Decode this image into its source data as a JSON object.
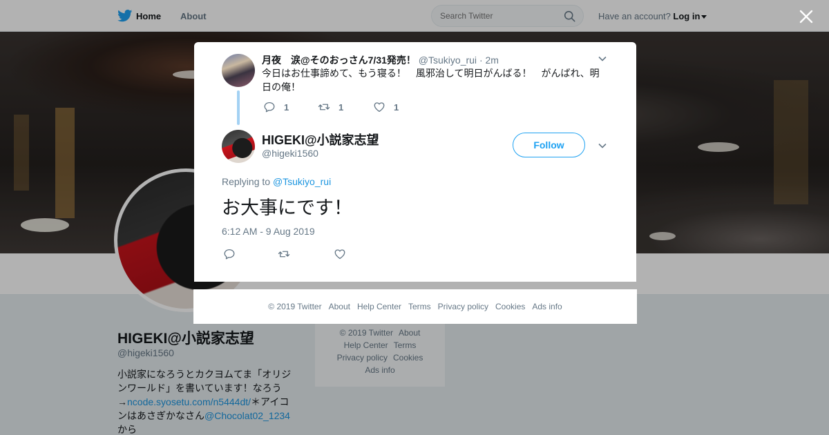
{
  "topbar": {
    "home_label": "Home",
    "about_label": "About",
    "search_placeholder": "Search Twitter",
    "account_prompt": "Have an account?",
    "login_label": "Log in"
  },
  "profile": {
    "name": "HIGEKI@小説家志望",
    "handle": "@higeki1560",
    "bio_part1": "小説家になろうとカクヨムてま「オリジンワールド」を書いています！なろう→",
    "bio_link1": "ncode.syosetu.com/n5444dt/",
    "bio_part2": "＊アイコンはあさぎかなさん",
    "bio_link2": "@Chocolat02_1234",
    "bio_part3": "から",
    "side_footer": {
      "copyright": "© 2019 Twitter",
      "about": "About",
      "help": "Help Center",
      "terms": "Terms",
      "privacy": "Privacy policy",
      "cookies": "Cookies",
      "ads": "Ads info"
    }
  },
  "modal": {
    "parent_tweet": {
      "name": "月夜　涙@そのおっさん7/31発売！",
      "handle": "@Tsukiyo_rui",
      "time": "· 2m",
      "text": "今日はお仕事諦めて、もう寝る！　風邪治して明日がんばる！　がんばれ、明日の俺！",
      "reply_count": "1",
      "retweet_count": "1",
      "like_count": "1"
    },
    "main_tweet": {
      "name": "HIGEKI@小説家志望",
      "handle": "@higeki1560",
      "follow_label": "Follow",
      "replying_label": "Replying to",
      "replying_handle": "@Tsukiyo_rui",
      "text": "お大事にです！",
      "timestamp": "6:12 AM - 9 Aug 2019"
    },
    "footer": {
      "copyright": "© 2019 Twitter",
      "about": "About",
      "help": "Help Center",
      "terms": "Terms",
      "privacy": "Privacy policy",
      "cookies": "Cookies",
      "ads": "Ads info"
    }
  },
  "icons": {
    "brand": "twitter-bird-icon",
    "close": "close-icon",
    "search": "search-icon"
  },
  "colors": {
    "accent": "#1da1f2",
    "link": "#1b95e0",
    "thread_line": "#a3d1f3"
  }
}
